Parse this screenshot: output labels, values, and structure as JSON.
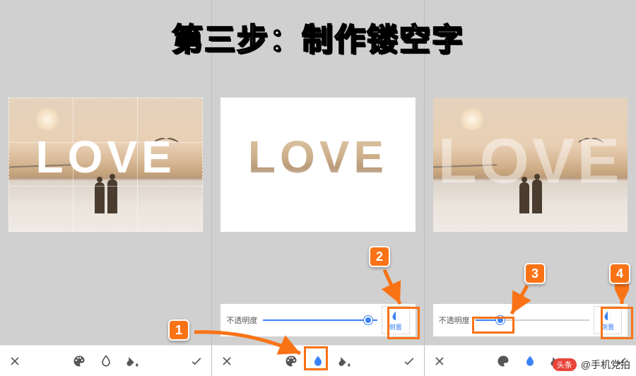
{
  "title": "第三步：制作镂空字",
  "love_text": "LOVE",
  "opacity_label": "不透明度",
  "invert_label": "倒置",
  "markers": {
    "m1": "1",
    "m2": "2",
    "m3": "3",
    "m4": "4"
  },
  "panels": {
    "p2_slider_pos_pct": 92,
    "p3_slider_pos_pct": 22
  },
  "watermark": {
    "badge": "头条",
    "text": "@手机党拍"
  }
}
